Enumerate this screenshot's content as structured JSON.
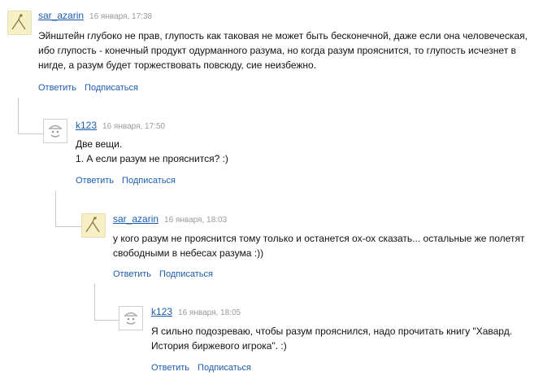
{
  "comments": [
    {
      "author": "sar_azarin",
      "date": "16 января, 17:38",
      "lines": [
        "Эйнштейн глубоко не прав, глупость как таковая не может быть бесконечной, даже если она человеческая,",
        "ибо глупость - конечный продукт одурманного разума, но когда разум прояснится, то глупость исчезнет в",
        "нигде, а разум будет торжествовать повсюду, сие неизбежно."
      ],
      "reply": "Ответить",
      "subscribe": "Подписаться"
    },
    {
      "author": "k123",
      "date": "16 января, 17:50",
      "lines": [
        "Две вещи.",
        "1. А если разум не прояснится? :)"
      ],
      "reply": "Ответить",
      "subscribe": "Подписаться"
    },
    {
      "author": "sar_azarin",
      "date": "16 января, 18:03",
      "lines": [
        "у кого разум не прояснится тому только и останется ох-ох сказать... остальные же полетят",
        "свободными в небесах разума :))"
      ],
      "reply": "Ответить",
      "subscribe": "Подписаться"
    },
    {
      "author": "k123",
      "date": "16 января, 18:05",
      "lines": [
        "Я сильно подозреваю, чтобы разум прояснился, надо прочитать книгу \"Хавард.",
        "История биржевого игрока\". :)"
      ],
      "reply": "Ответить",
      "subscribe": "Подписаться"
    }
  ]
}
